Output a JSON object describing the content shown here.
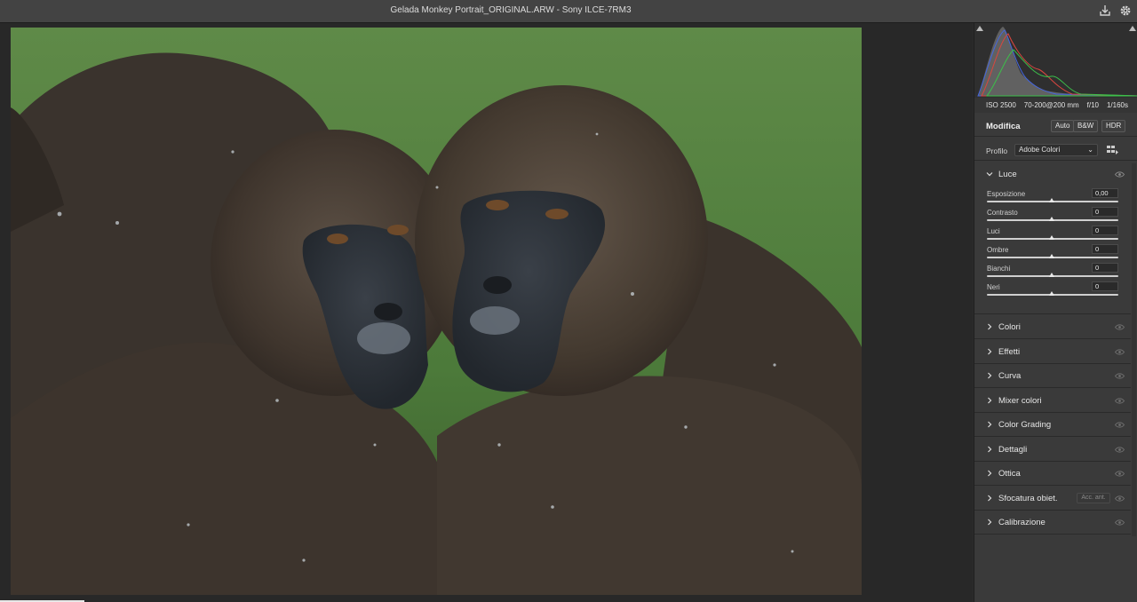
{
  "window": {
    "title": "Gelada Monkey Portrait_ORIGINAL.ARW  -  Sony ILCE-7RM3",
    "export_icon": "export-icon",
    "settings_icon": "gear-icon"
  },
  "exif": {
    "iso": "ISO 2500",
    "lens": "70-200@200 mm",
    "aperture": "f/10",
    "shutter": "1/160s"
  },
  "edit": {
    "title": "Modifica",
    "auto_label": "Auto",
    "bw_label": "B&W",
    "hdr_label": "HDR"
  },
  "profile": {
    "label": "Profilo",
    "value": "Adobe Colori"
  },
  "light": {
    "label": "Luce",
    "sliders": [
      {
        "label": "Esposizione",
        "value": "0,00"
      },
      {
        "label": "Contrasto",
        "value": "0"
      },
      {
        "label": "Luci",
        "value": "0"
      },
      {
        "label": "Ombre",
        "value": "0"
      },
      {
        "label": "Bianchi",
        "value": "0"
      },
      {
        "label": "Neri",
        "value": "0"
      }
    ]
  },
  "sections": [
    {
      "label": "Colori"
    },
    {
      "label": "Effetti"
    },
    {
      "label": "Curva"
    },
    {
      "label": "Mixer colori"
    },
    {
      "label": "Color Grading"
    },
    {
      "label": "Dettagli"
    },
    {
      "label": "Ottica"
    },
    {
      "label": "Sfocatura obiet.",
      "button": "Acc. ant."
    },
    {
      "label": "Calibrazione"
    }
  ],
  "colors": {
    "panel_bg": "#3a3a3a",
    "titlebar_bg": "#434343",
    "canvas_bg": "#282828",
    "histogram_red": "#d9463f",
    "histogram_green": "#3cbf4a",
    "histogram_blue": "#4466e0"
  }
}
